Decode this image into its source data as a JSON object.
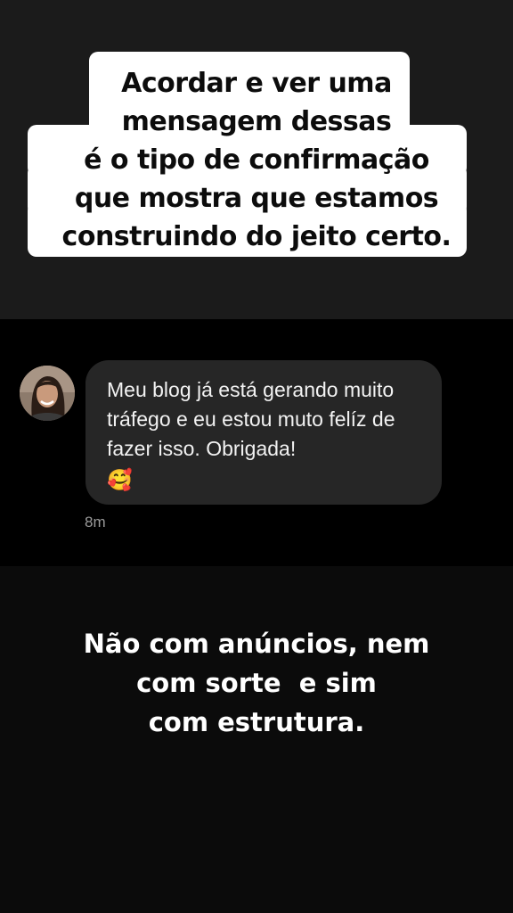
{
  "story": {
    "headline_lines": [
      "Acordar e ver uma",
      "mensagem dessas",
      "é o tipo de confirmação",
      "que mostra que estamos",
      "construindo do jeito certo."
    ],
    "message": {
      "text": "Meu blog já está gerando muito tráfego e eu estou muto felíz de fazer isso. Obrigada!",
      "emoji": "🥰",
      "time": "8m"
    },
    "closing_lines": [
      "Não com anúncios, nem",
      "com sorte  e sim",
      "com estrutura."
    ]
  },
  "colors": {
    "headline_background": "#ffffff",
    "bubble_background": "#262626",
    "page_background": "#161616"
  },
  "icons": {
    "avatar": "user-avatar-photo"
  }
}
